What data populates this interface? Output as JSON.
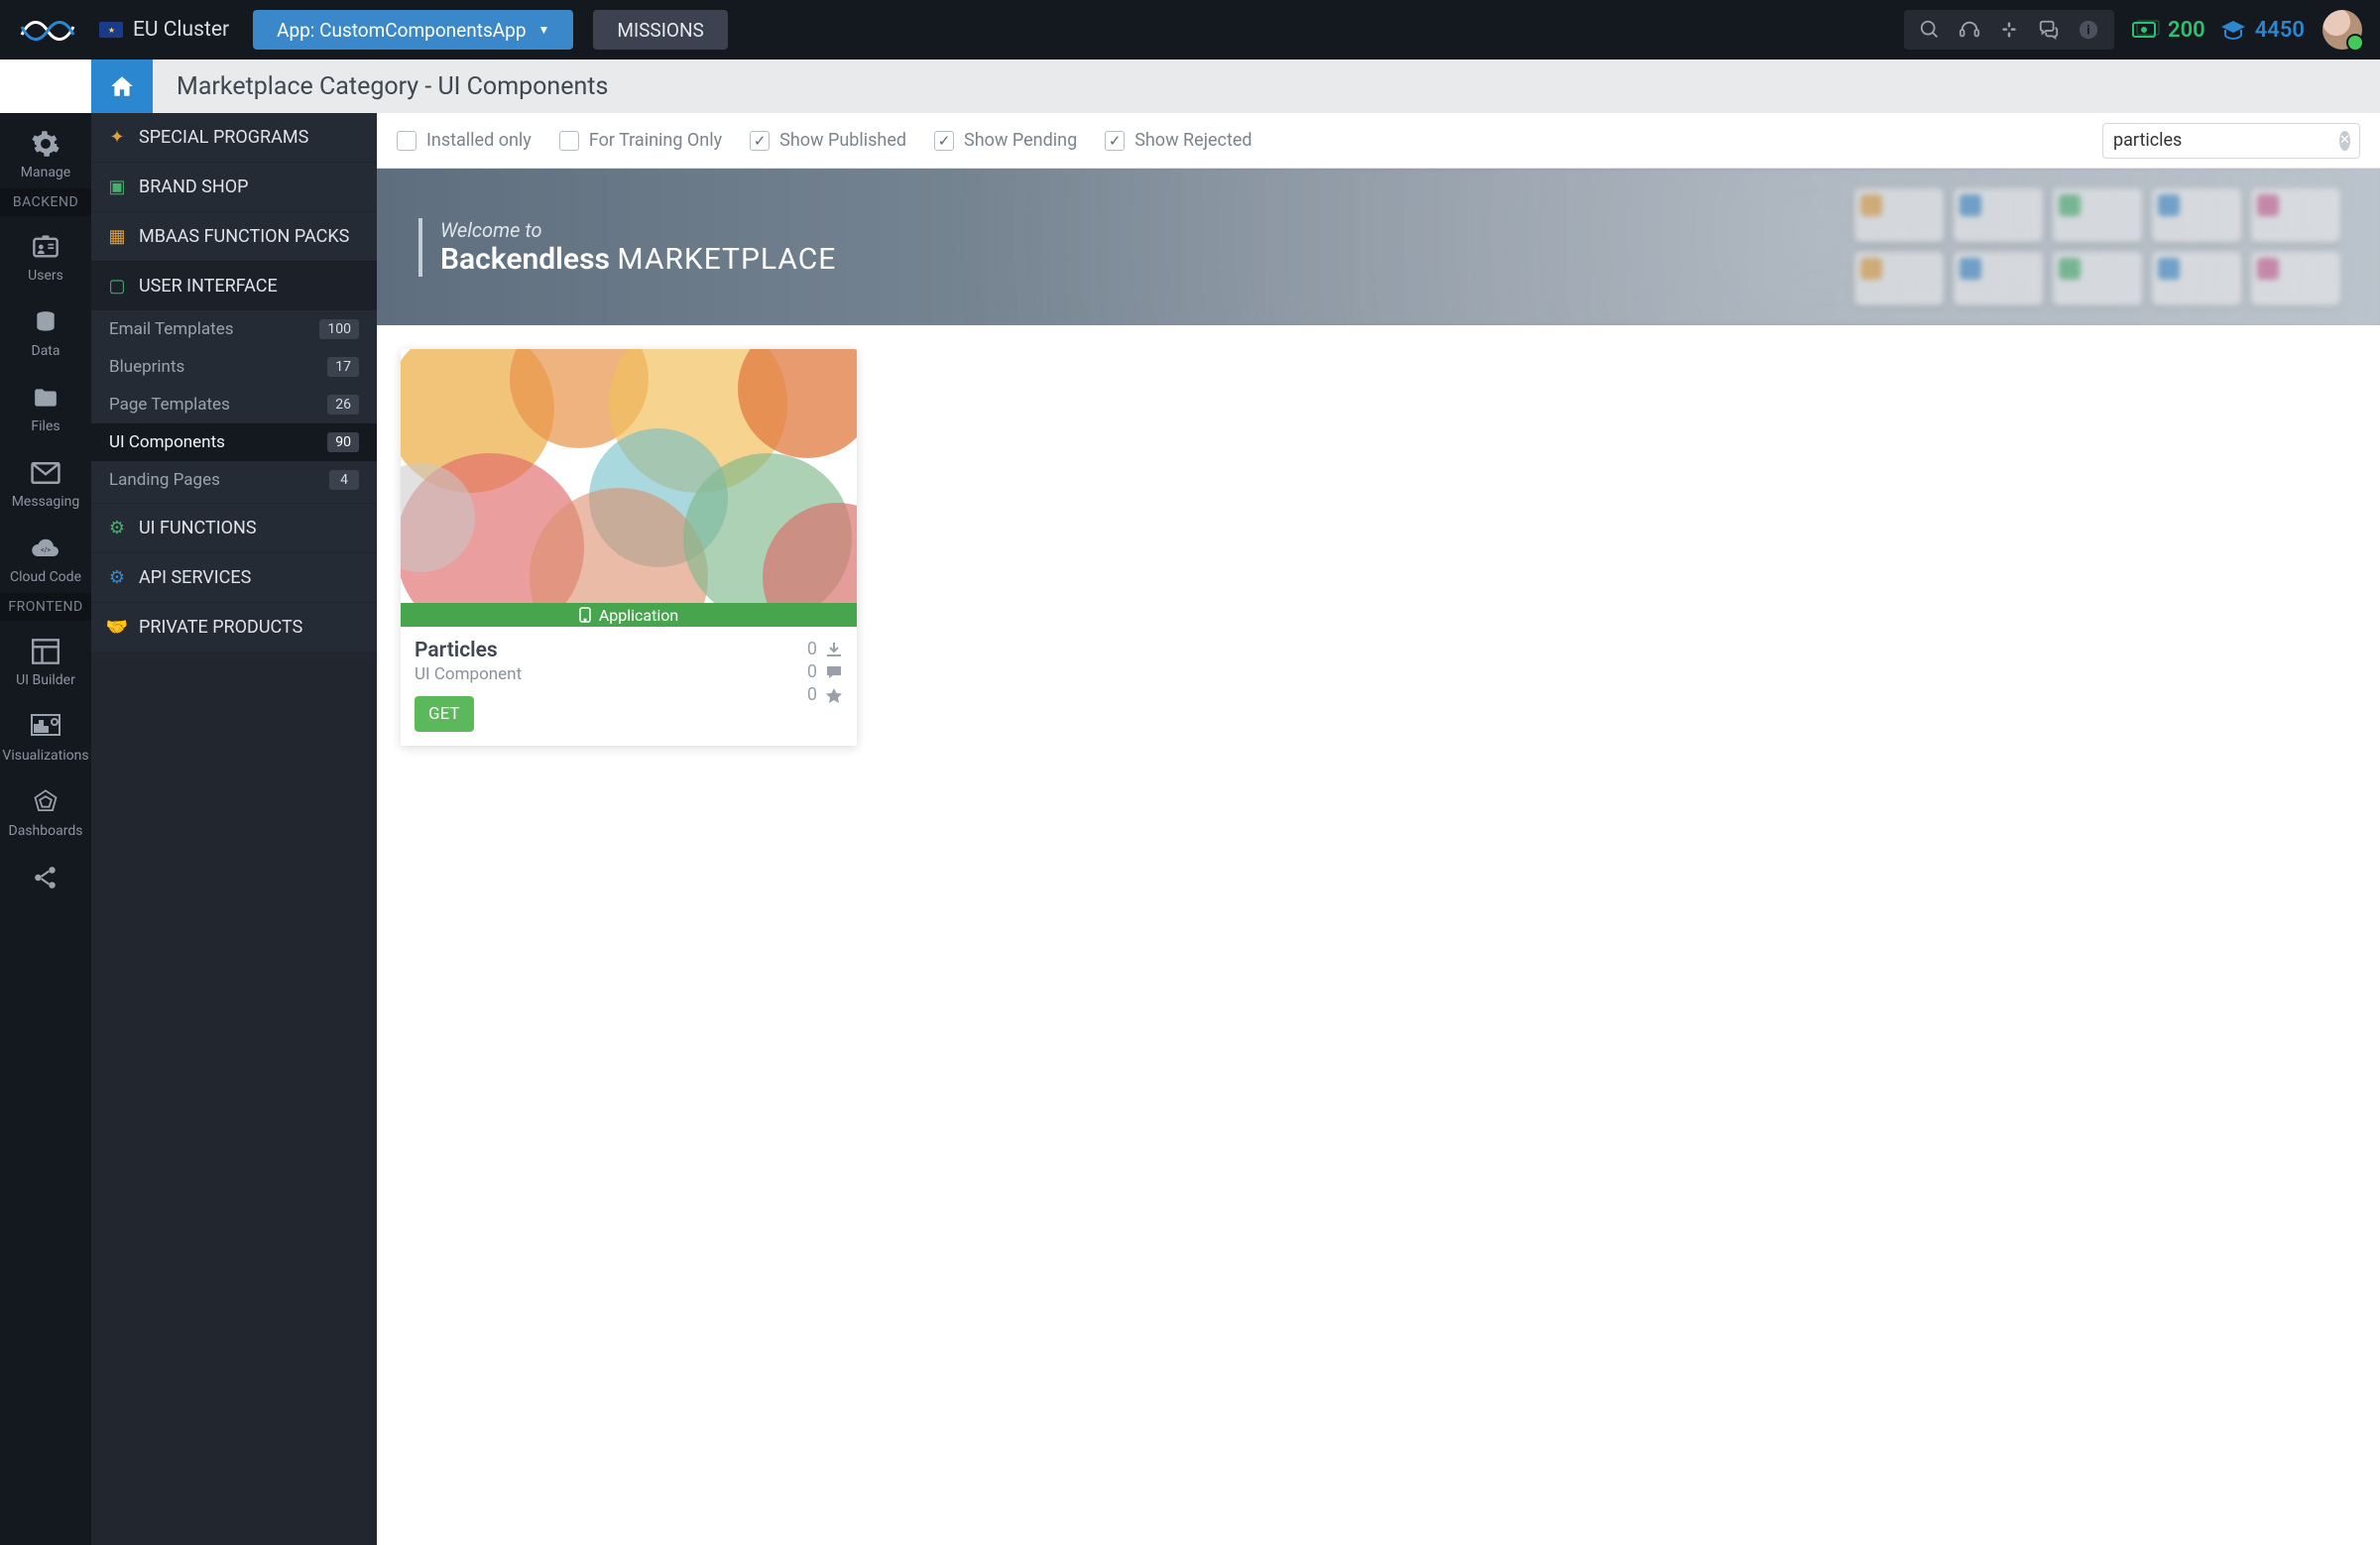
{
  "topbar": {
    "cluster_label": "EU Cluster",
    "app_label": "App: CustomComponentsApp",
    "missions_label": "MISSIONS",
    "balance": "200",
    "grad_points": "4450"
  },
  "header": {
    "title": "Marketplace Category - UI Components"
  },
  "leftrail": {
    "section_backend": "BACKEND",
    "section_frontend": "FRONTEND",
    "items": [
      {
        "label": "Manage"
      },
      {
        "label": "Users"
      },
      {
        "label": "Data"
      },
      {
        "label": "Files"
      },
      {
        "label": "Messaging"
      },
      {
        "label": "Cloud Code"
      },
      {
        "label": "UI Builder"
      },
      {
        "label": "Visualizations"
      },
      {
        "label": "Dashboards"
      }
    ]
  },
  "sidecol": {
    "categories": [
      {
        "label": "SPECIAL PROGRAMS"
      },
      {
        "label": "BRAND SHOP"
      },
      {
        "label": "MBAAS FUNCTION PACKS"
      },
      {
        "label": "USER INTERFACE"
      },
      {
        "label": "UI FUNCTIONS"
      },
      {
        "label": "API SERVICES"
      },
      {
        "label": "PRIVATE PRODUCTS"
      }
    ],
    "ui_subitems": [
      {
        "label": "Email Templates",
        "count": "100"
      },
      {
        "label": "Blueprints",
        "count": "17"
      },
      {
        "label": "Page Templates",
        "count": "26"
      },
      {
        "label": "UI Components",
        "count": "90"
      },
      {
        "label": "Landing Pages",
        "count": "4"
      }
    ]
  },
  "filters": {
    "installed_only": "Installed only",
    "training_only": "For Training Only",
    "show_published": "Show Published",
    "show_pending": "Show Pending",
    "show_rejected": "Show Rejected",
    "search_value": "particles"
  },
  "banner": {
    "line1": "Welcome to",
    "line2_a": "Backendless ",
    "line2_b": "MARKETPLACE"
  },
  "card": {
    "strip_label": "Application",
    "name": "Particles",
    "subtitle": "UI Component",
    "get_label": "GET",
    "downloads": "0",
    "comments": "0",
    "stars": "0"
  }
}
